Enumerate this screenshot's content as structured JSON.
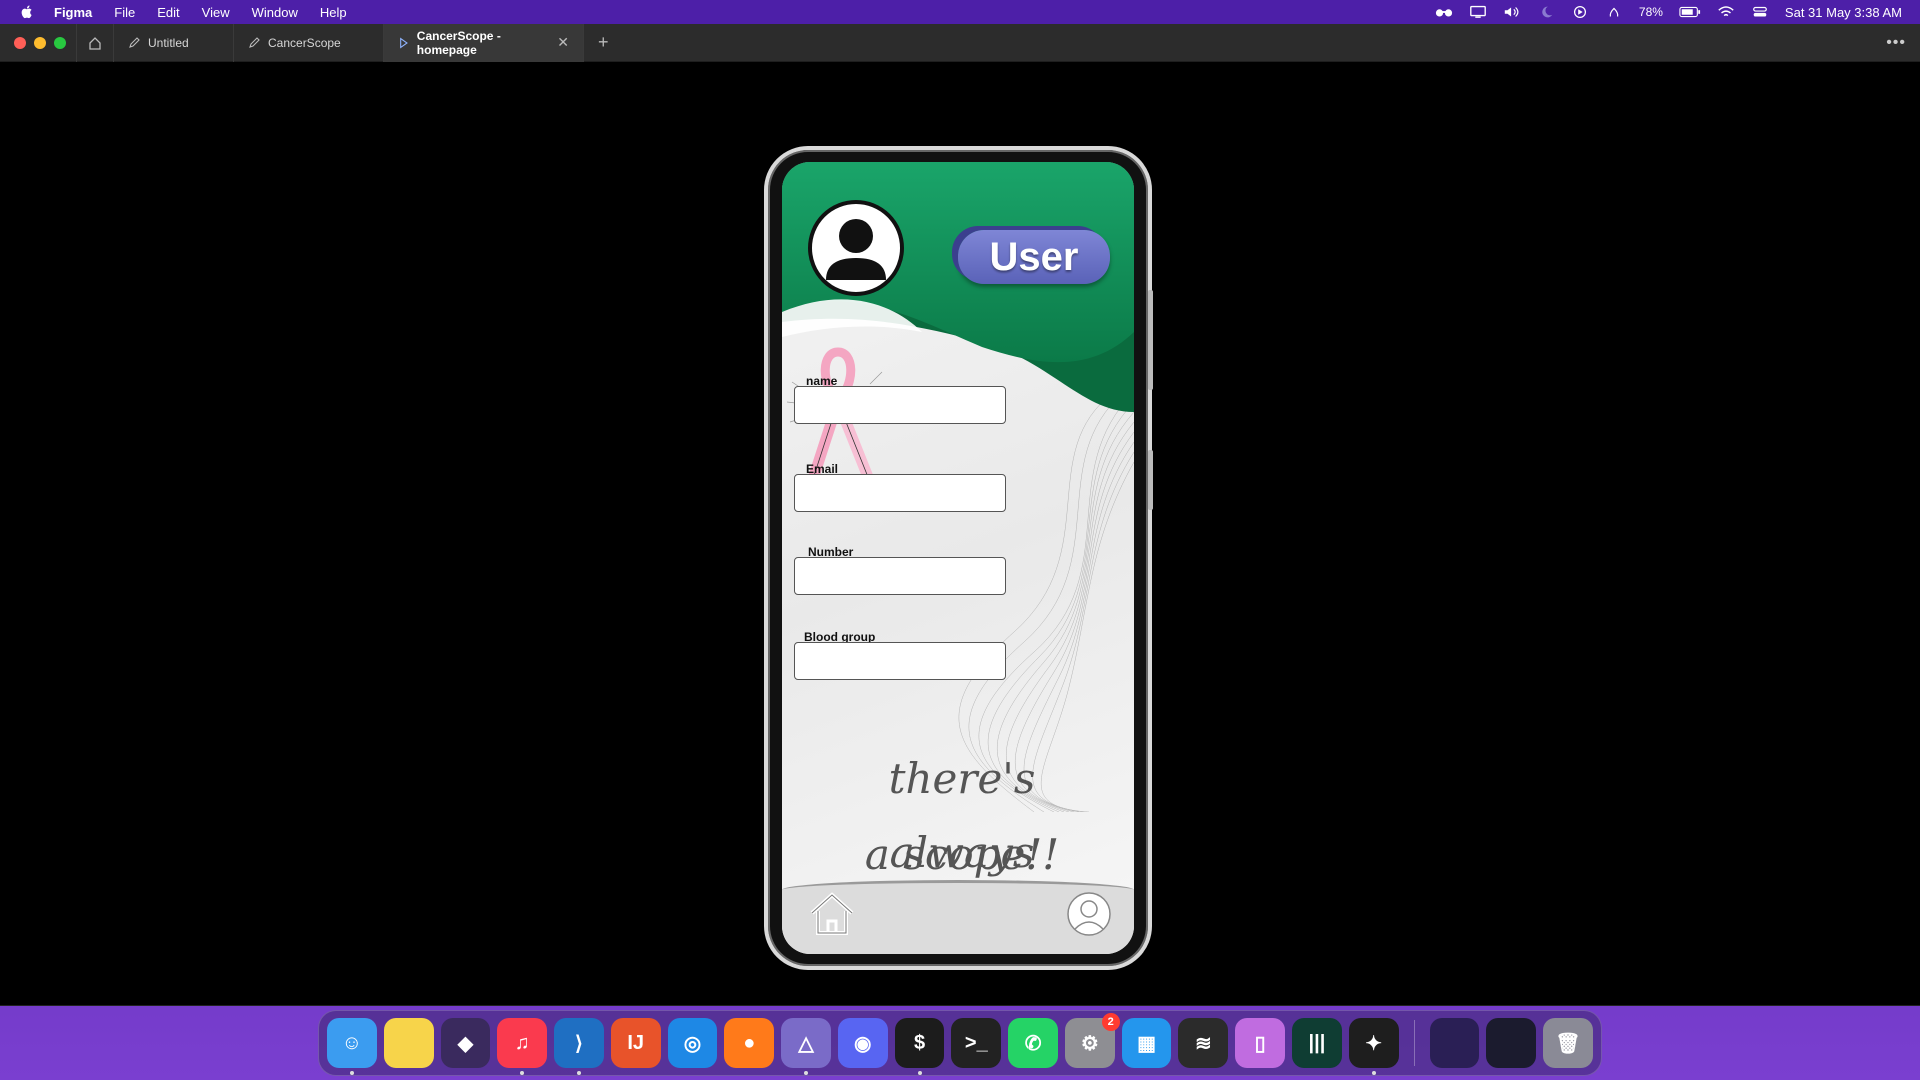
{
  "menubar": {
    "app_name": "Figma",
    "menus": [
      "File",
      "Edit",
      "View",
      "Window",
      "Help"
    ],
    "battery": "78%",
    "datetime": "Sat 31 May  3:38 AM"
  },
  "tabs": [
    {
      "label": "Untitled",
      "icon": "pen-icon"
    },
    {
      "label": "CancerScope",
      "icon": "pen-icon"
    },
    {
      "label": "CancerScope - homepage",
      "icon": "play-icon",
      "active": true
    }
  ],
  "phone": {
    "user_button": "User",
    "fields": [
      {
        "label": "name"
      },
      {
        "label": "Email"
      },
      {
        "label": "Number"
      },
      {
        "label": "Blood group"
      }
    ],
    "tagline_line1": "there's always",
    "tagline_line2": "a scope!!"
  },
  "dock": {
    "apps": [
      {
        "name": "finder",
        "color": "#3b9cf0",
        "glyph": "☺"
      },
      {
        "name": "notes",
        "color": "#f7d44a",
        "glyph": ""
      },
      {
        "name": "obsidian",
        "color": "#3a2a5e",
        "glyph": "◆"
      },
      {
        "name": "music",
        "color": "#fa3a4e",
        "glyph": "♫"
      },
      {
        "name": "vscode",
        "color": "#1f6fc2",
        "glyph": "⟩"
      },
      {
        "name": "intellij",
        "color": "#e8532a",
        "glyph": "IJ"
      },
      {
        "name": "safari",
        "color": "#1e88e5",
        "glyph": "◎"
      },
      {
        "name": "firefox",
        "color": "#ff7a1a",
        "glyph": "●"
      },
      {
        "name": "affinity",
        "color": "#7a6bc8",
        "glyph": "△"
      },
      {
        "name": "discord",
        "color": "#5865f2",
        "glyph": "◉"
      },
      {
        "name": "terminal-dark",
        "color": "#1c1c1c",
        "glyph": "$"
      },
      {
        "name": "terminal",
        "color": "#222222",
        "glyph": ">_"
      },
      {
        "name": "whatsapp",
        "color": "#25d366",
        "glyph": "✆"
      },
      {
        "name": "system-settings",
        "color": "#8e8e93",
        "glyph": "⚙",
        "badge": "2"
      },
      {
        "name": "docker",
        "color": "#2496ed",
        "glyph": "▦"
      },
      {
        "name": "audio",
        "color": "#2b2b2b",
        "glyph": "≋"
      },
      {
        "name": "simulator",
        "color": "#c06ce0",
        "glyph": "▯"
      },
      {
        "name": "waveform",
        "color": "#0f3d33",
        "glyph": "|||"
      },
      {
        "name": "figma",
        "color": "#1e1e1e",
        "glyph": "✦"
      }
    ]
  }
}
